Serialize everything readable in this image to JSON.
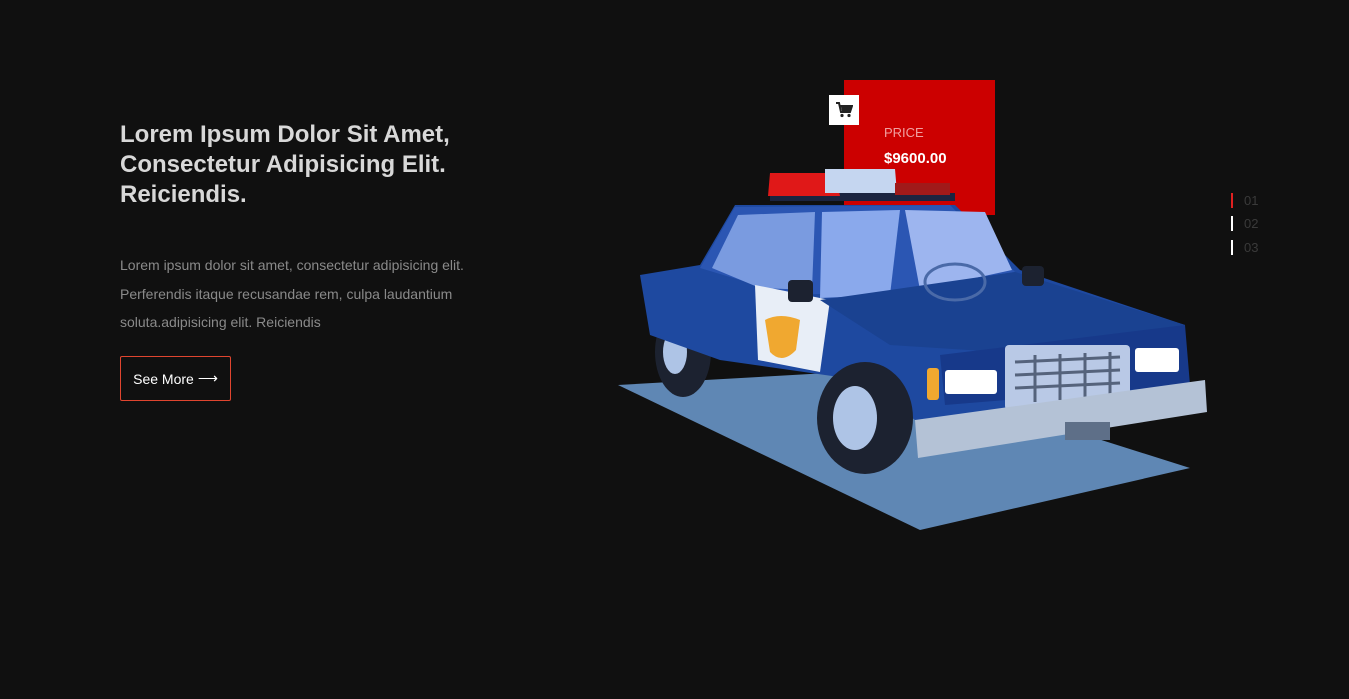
{
  "hero": {
    "title": "Lorem Ipsum Dolor Sit Amet, Consectetur Adipisicing Elit. Reiciendis.",
    "description": "Lorem ipsum dolor sit amet, consectetur adipisicing elit. Perferendis itaque recusandae rem, culpa laudantium soluta.adipisicing elit. Reiciendis",
    "button_label": "See More",
    "button_icon": "arrow-right-icon"
  },
  "product": {
    "price_label": "PRICE",
    "price_value": "$9600.00",
    "cart_icon": "cart-icon",
    "image": "police-car-illustration"
  },
  "slider": {
    "items": [
      {
        "label": "01",
        "active": true
      },
      {
        "label": "02",
        "active": false
      },
      {
        "label": "03",
        "active": false
      }
    ]
  },
  "colors": {
    "background": "#101010",
    "accent_red": "#cc0000",
    "button_border": "#e0452f",
    "car_blue": "#1f4aa0"
  }
}
